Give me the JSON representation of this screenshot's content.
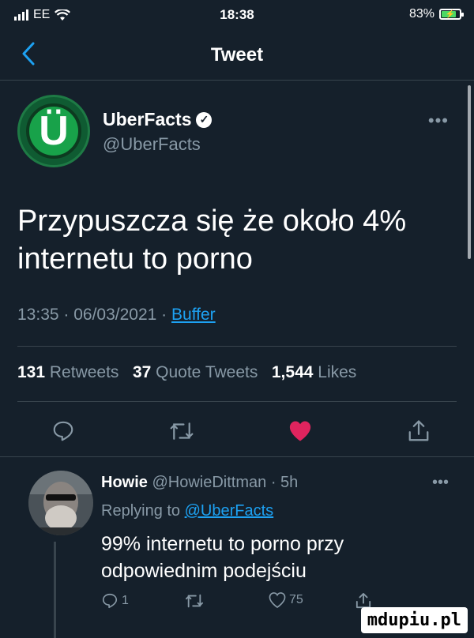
{
  "status_bar": {
    "carrier": "EE",
    "time": "18:38",
    "battery_percent": "83%",
    "battery_level": 0.83,
    "battery_color": "#4cd964"
  },
  "nav": {
    "title": "Tweet",
    "back_icon": "chevron-left-icon"
  },
  "tweet": {
    "author_name": "UberFacts",
    "author_handle": "@UberFacts",
    "avatar_letter": "Ü",
    "text": "Przypuszcza się że około 4% internetu to porno",
    "time": "13:35",
    "date": "06/03/2021",
    "separator": " · ",
    "source": "Buffer",
    "stats": {
      "retweets_count": "131",
      "retweets_label": "Retweets",
      "quotes_count": "37",
      "quotes_label": "Quote Tweets",
      "likes_count": "1,544",
      "likes_label": "Likes"
    },
    "liked": true,
    "like_color": "#e0245e"
  },
  "reply": {
    "author_name": "Howie",
    "author_handle": "@HowieDittman",
    "age": "· 5h",
    "replying_prefix": "Replying to",
    "replying_to": "@UberFacts",
    "text": "99% internetu to porno przy odpowiednim podejściu",
    "reply_count": "1",
    "retweet_count": "",
    "like_count": "75"
  },
  "colors": {
    "background": "#15202b",
    "secondary_text": "#8899a6",
    "link": "#1da1f2",
    "divider": "#38444d"
  },
  "watermark": "mdupiu.pl"
}
